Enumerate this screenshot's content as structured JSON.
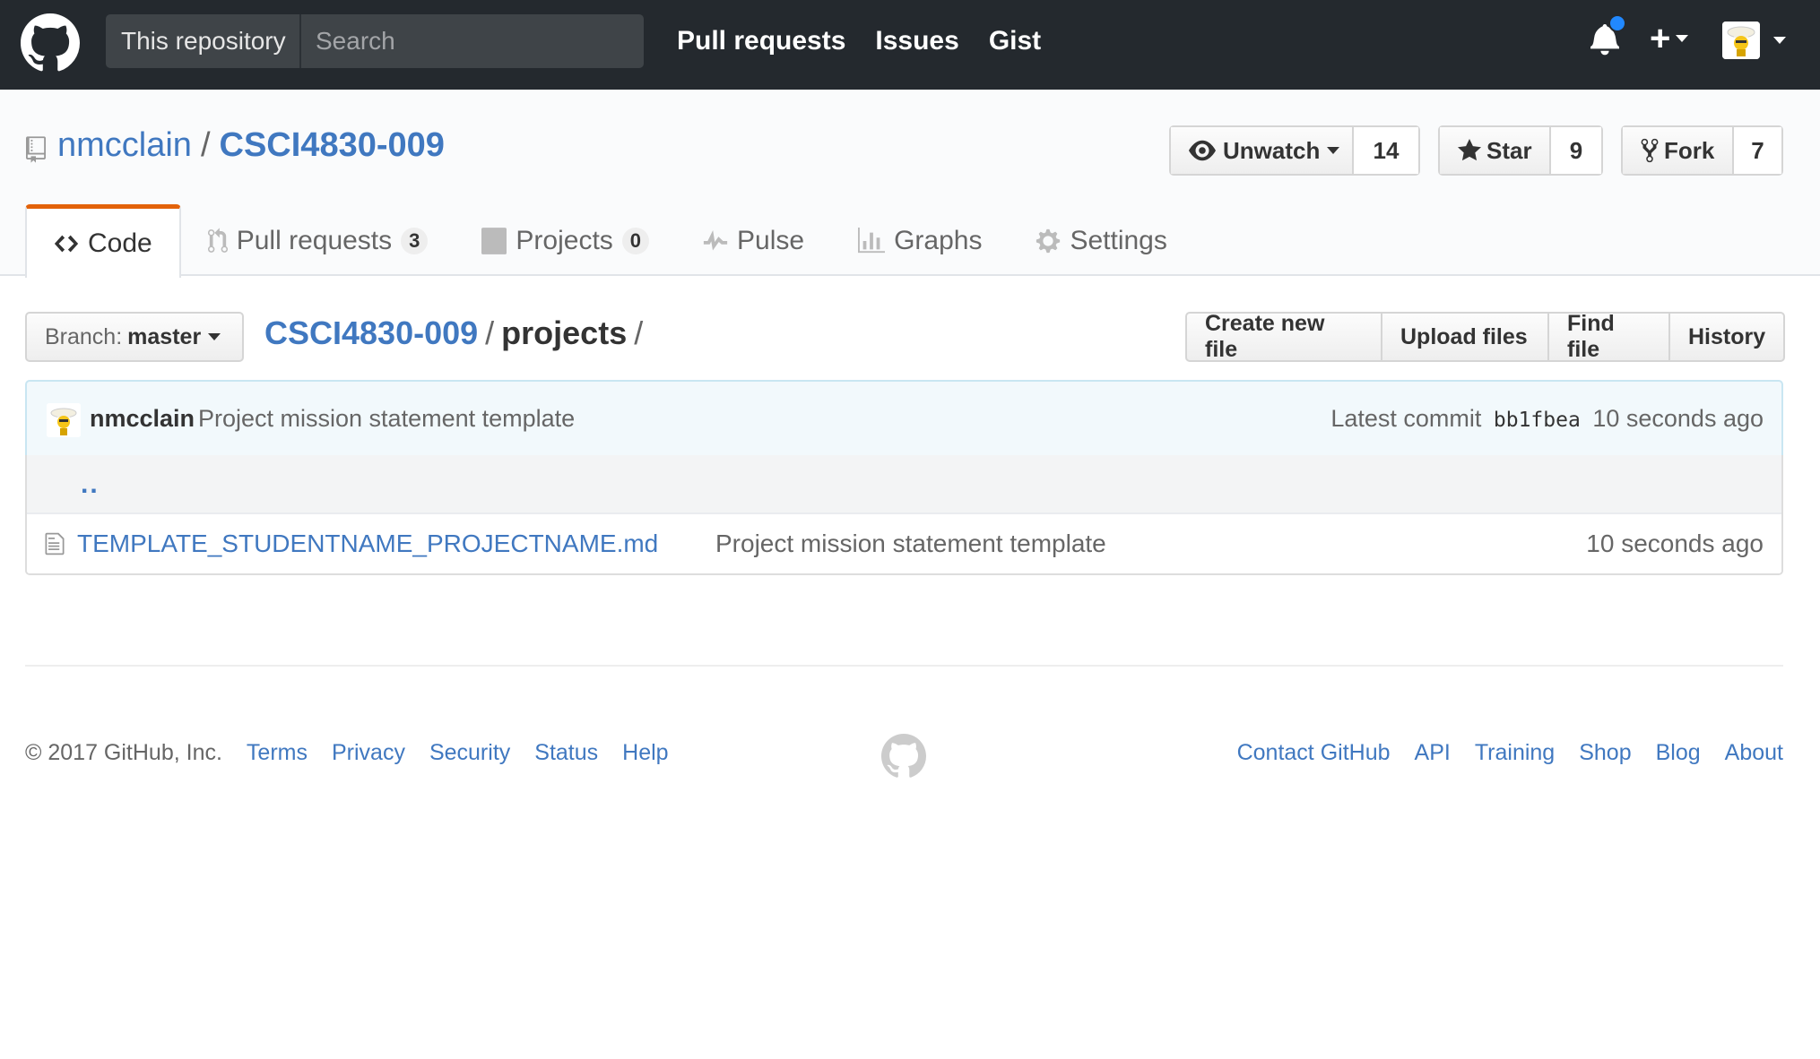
{
  "header": {
    "scope_label": "This repository",
    "search_placeholder": "Search",
    "nav": [
      "Pull requests",
      "Issues",
      "Gist"
    ],
    "notification_color": "#2188ff"
  },
  "repo": {
    "owner": "nmcclain",
    "separator": "/",
    "name": "CSCI4830-009",
    "watch": {
      "label": "Unwatch",
      "count": "14"
    },
    "star": {
      "label": "Star",
      "count": "9"
    },
    "fork": {
      "label": "Fork",
      "count": "7"
    }
  },
  "tabs": [
    {
      "label": "Code",
      "icon": "code-icon",
      "selected": true
    },
    {
      "label": "Pull requests",
      "icon": "pull-request-icon",
      "counter": "3"
    },
    {
      "label": "Projects",
      "icon": "project-icon",
      "counter": "0"
    },
    {
      "label": "Pulse",
      "icon": "pulse-icon"
    },
    {
      "label": "Graphs",
      "icon": "graph-icon"
    },
    {
      "label": "Settings",
      "icon": "gear-icon"
    }
  ],
  "filenav": {
    "branch_label": "Branch:",
    "branch_value": "master",
    "path_root": "CSCI4830-009",
    "path_sep": "/",
    "path_current": "projects",
    "path_trailing": "/",
    "actions": [
      "Create new file",
      "Upload files",
      "Find file",
      "History"
    ]
  },
  "commit": {
    "author": "nmcclain",
    "message": "Project mission statement template",
    "latest_label": "Latest commit",
    "sha": "bb1fbea",
    "age": "10 seconds ago"
  },
  "files": {
    "up": "..",
    "rows": [
      {
        "name": "TEMPLATE_STUDENTNAME_PROJECTNAME.md",
        "message": "Project mission statement template",
        "age": "10 seconds ago"
      }
    ]
  },
  "footer": {
    "copyright": "© 2017 GitHub, Inc.",
    "left_links": [
      "Terms",
      "Privacy",
      "Security",
      "Status",
      "Help"
    ],
    "right_links": [
      "Contact GitHub",
      "API",
      "Training",
      "Shop",
      "Blog",
      "About"
    ]
  },
  "colors": {
    "accent": "#e36209",
    "link": "#4078c0",
    "header_bg": "#24292e"
  }
}
